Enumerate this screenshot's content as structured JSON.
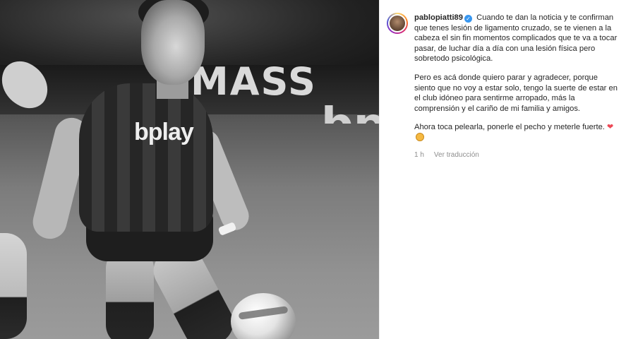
{
  "post": {
    "username": "pablopiatti89",
    "verified_mark": "✓",
    "caption_p1": "Cuando te dan la noticia y te confirman que tenes lesión de ligamento cruzado, se te vienen a la cabeza el sin fin momentos complicados que te va a tocar pasar, de luchar día a día con una lesión física pero sobretodo psicológica.",
    "caption_p2": "Pero es acá donde quiero parar y agradecer, porque siento que no voy a estar solo, tengo la suerte de estar en el club idóneo para sentirme arropado, más la comprensión y el cariño de mi familia y amigos.",
    "caption_p3": "Ahora toca pelearla, ponerle el pecho y meterle fuerte.",
    "heart_emoji": "❤",
    "time_ago": "1 h",
    "translate_label": "Ver traducción"
  },
  "photo": {
    "board_text": "MASS",
    "bp_text": "bp",
    "shirt_sponsor": "bplay"
  },
  "colors": {
    "verified": "#3897f0",
    "heart": "#ed4956",
    "meta_text": "#8e8e8e"
  },
  "icons": [
    "verified-icon",
    "heart-icon",
    "emoji-face-icon"
  ]
}
